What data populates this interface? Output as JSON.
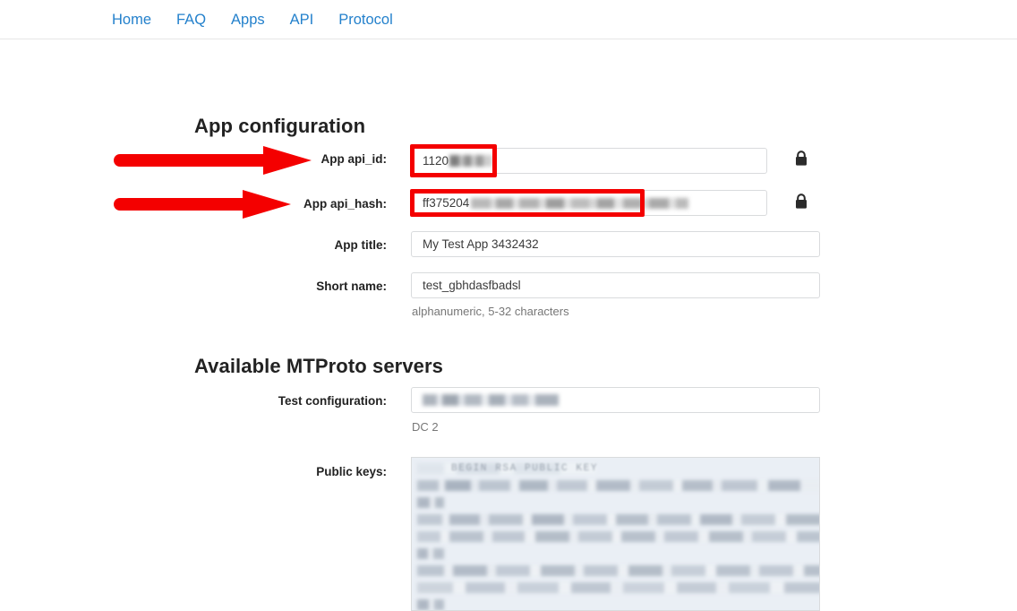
{
  "nav": {
    "items": [
      {
        "label": "Home"
      },
      {
        "label": "FAQ"
      },
      {
        "label": "Apps"
      },
      {
        "label": "API"
      },
      {
        "label": "Protocol"
      }
    ]
  },
  "app_configuration": {
    "title": "App configuration",
    "fields": [
      {
        "label": "App api_id:",
        "value_visible": "1120",
        "redacted": true,
        "lock_icon": "lock-icon",
        "highlighted": true
      },
      {
        "label": "App api_hash:",
        "value_visible": "ff375204",
        "redacted": true,
        "lock_icon": "lock-icon",
        "highlighted": true
      },
      {
        "label": "App title:",
        "value_visible": "My Test App 3432432",
        "redacted": false,
        "highlighted": false
      },
      {
        "label": "Short name:",
        "value_visible": "test_gbhdasfbadsl",
        "redacted": false,
        "highlighted": false,
        "hint": "alphanumeric, 5-32 characters"
      }
    ]
  },
  "mtproto_servers": {
    "title": "Available MTProto servers",
    "test_configuration": {
      "label": "Test configuration:",
      "value_visible": "",
      "redacted": true,
      "hint": "DC 2"
    },
    "public_keys": {
      "label": "Public keys:",
      "header_text": "BEGIN RSA PUBLIC KEY",
      "redacted": true
    }
  },
  "annotations": {
    "arrow_color": "#f40000",
    "rect_color": "#f40000",
    "arrows": [
      {
        "target": "App api_id:"
      },
      {
        "target": "App api_hash:"
      }
    ]
  }
}
